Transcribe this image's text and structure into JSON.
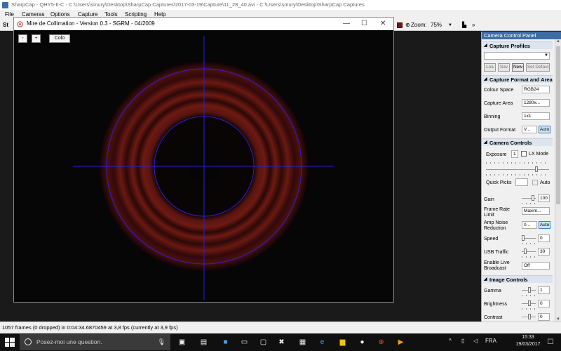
{
  "main_window": {
    "title": "SharpCap - QHY5-II-C - C:\\Users\\smury\\Desktop\\SharpCap Captures\\2017-03-19\\Capture\\11_28_40.avi - C:\\Users\\smury\\Desktop\\SharpCap Captures"
  },
  "menu": {
    "items": [
      "File",
      "Cameras",
      "Options",
      "Capture",
      "Tools",
      "Scripting",
      "Help"
    ]
  },
  "toolbar": {
    "start_label": "St",
    "zoom_label": "Zoom:",
    "zoom_value": "75%"
  },
  "collimation_window": {
    "title": "Mire de Collimation - Version 0.3 - SGRM - 04/2009",
    "minus_button": "-",
    "plus_button": "+",
    "color_button": "Colo"
  },
  "colors": {
    "reticle": "#2b1fd6",
    "rings": "#7a1a12",
    "panel_header": "#3c6ea3",
    "taskbar": "#101010"
  },
  "panel": {
    "title": "Camera Control Panel",
    "capture_profiles": {
      "header": "Capture Profiles",
      "profile_value": "",
      "buttons": [
        "Loa",
        "Sav",
        "New",
        "Set Defaul"
      ]
    },
    "capture_format": {
      "header": "Capture Format and Area",
      "colour_space_label": "Colour Space",
      "colour_space_value": "RGB24",
      "capture_area_label": "Capture Area",
      "capture_area_value": "1280x...",
      "binning_label": "Binning",
      "binning_value": "1x1",
      "output_format_label": "Output Format",
      "output_format_value": "V...",
      "auto_label": "Auto"
    },
    "camera_controls": {
      "header": "Camera Controls",
      "exposure_label": "Exposure",
      "exposure_value": "1",
      "lx_mode_label": "LX Mode",
      "quick_picks_label": "Quick Picks",
      "quick_auto_label": "Auto",
      "gain_label": "Gain",
      "gain_value": "100",
      "frame_rate_label": "Frame Rate Limit",
      "frame_rate_value": "Maxim...",
      "amp_noise_label": "Amp Noise Reduction",
      "amp_noise_value": "0...",
      "amp_auto_label": "Auto",
      "speed_label": "Speed",
      "speed_value": "0",
      "usb_label": "USB Traffic",
      "usb_value": "30",
      "live_broadcast_label": "Enable Live Broadcast",
      "live_broadcast_value": "Off"
    },
    "image_controls": {
      "header": "Image Controls",
      "gamma_label": "Gamma",
      "gamma_value": "1",
      "brightness_label": "Brightness",
      "brightness_value": "0",
      "contrast_label": "Contrast",
      "contrast_value": "0"
    }
  },
  "status": {
    "text": "1057 frames (0 dropped) in 0:04:34.6870459 at 3,8 fps  (currently at 3,9 fps)"
  },
  "taskbar": {
    "search_placeholder": "Posez-moi une question.",
    "language": "FRA",
    "time": "15:33",
    "date": "19/03/2017"
  }
}
